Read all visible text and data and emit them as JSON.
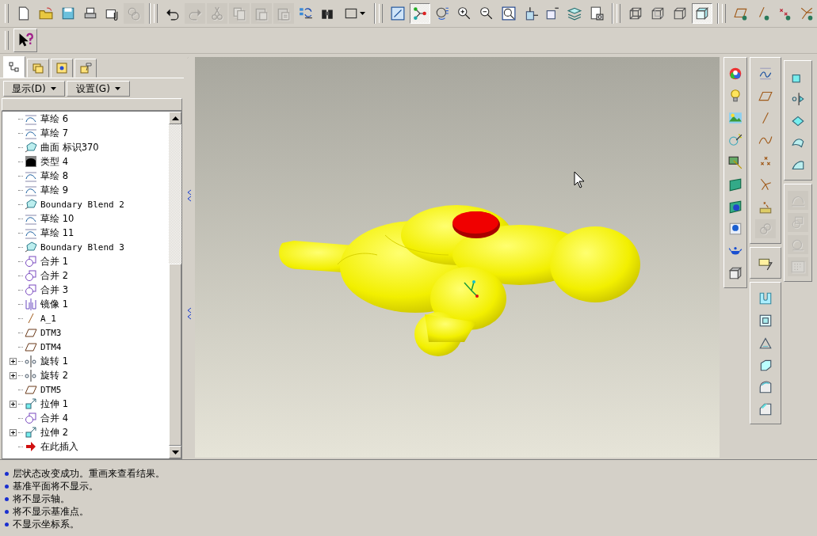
{
  "main_toolbar": {
    "buttons": [
      {
        "selected": false,
        "disabled": false
      },
      {
        "selected": false,
        "disabled": false
      },
      {
        "selected": false,
        "disabled": false
      },
      {
        "selected": false,
        "disabled": false
      },
      {
        "selected": false,
        "disabled": false
      },
      {
        "selected": false,
        "disabled": true
      },
      {
        "selected": false,
        "disabled": false
      },
      {
        "selected": false,
        "disabled": true
      },
      {
        "selected": false,
        "disabled": true
      },
      {
        "selected": false,
        "disabled": true
      },
      {
        "selected": false,
        "disabled": true
      },
      {
        "selected": false,
        "disabled": true
      },
      {
        "selected": false,
        "disabled": false
      },
      {
        "selected": false,
        "disabled": false
      },
      {
        "selected": false,
        "disabled": false
      },
      {
        "selected": false,
        "disabled": false
      },
      {
        "selected": true,
        "disabled": false
      },
      {
        "selected": false,
        "disabled": false
      },
      {
        "selected": false,
        "disabled": false
      },
      {
        "selected": false,
        "disabled": false
      },
      {
        "selected": false,
        "disabled": false
      },
      {
        "selected": false,
        "disabled": false
      },
      {
        "selected": false,
        "disabled": false
      },
      {
        "selected": false,
        "disabled": false
      },
      {
        "selected": false,
        "disabled": false
      },
      {
        "selected": false,
        "disabled": false
      },
      {
        "selected": false,
        "disabled": false
      },
      {
        "selected": false,
        "disabled": false
      },
      {
        "selected": true,
        "disabled": false
      },
      {
        "selected": false,
        "disabled": false
      },
      {
        "selected": false,
        "disabled": false
      },
      {
        "selected": false,
        "disabled": false
      },
      {
        "selected": false,
        "disabled": false
      }
    ]
  },
  "model_tree": {
    "tabs": [
      {
        "selected": true
      },
      {
        "selected": false
      },
      {
        "selected": false
      },
      {
        "selected": false
      }
    ],
    "menus": [
      {
        "label": "显示(D)"
      },
      {
        "label": "设置(G)"
      }
    ],
    "items": [
      {
        "kind": "sketch",
        "label": "草绘 6",
        "expandable": false
      },
      {
        "kind": "sketch",
        "label": "草绘 7",
        "expandable": false
      },
      {
        "kind": "surface",
        "label": "曲面 标识370",
        "expandable": false
      },
      {
        "kind": "type",
        "label": "类型 4",
        "expandable": false
      },
      {
        "kind": "sketch",
        "label": "草绘 8",
        "expandable": false
      },
      {
        "kind": "sketch",
        "label": "草绘 9",
        "expandable": false
      },
      {
        "kind": "surface",
        "label": "Boundary Blend 2",
        "expandable": false
      },
      {
        "kind": "sketch",
        "label": "草绘 10",
        "expandable": false
      },
      {
        "kind": "sketch",
        "label": "草绘 11",
        "expandable": false
      },
      {
        "kind": "surface",
        "label": "Boundary Blend 3",
        "expandable": false
      },
      {
        "kind": "merge",
        "label": "合并 1",
        "expandable": false
      },
      {
        "kind": "merge",
        "label": "合并 2",
        "expandable": false
      },
      {
        "kind": "merge",
        "label": "合并 3",
        "expandable": false
      },
      {
        "kind": "mirror",
        "label": "镜像 1",
        "expandable": false
      },
      {
        "kind": "axis",
        "label": "A_1",
        "expandable": false
      },
      {
        "kind": "plane",
        "label": "DTM3",
        "expandable": false
      },
      {
        "kind": "plane",
        "label": "DTM4",
        "expandable": false
      },
      {
        "kind": "revolve",
        "label": "旋转 1",
        "expandable": true
      },
      {
        "kind": "revolve",
        "label": "旋转 2",
        "expandable": true
      },
      {
        "kind": "plane",
        "label": "DTM5",
        "expandable": false
      },
      {
        "kind": "extrude",
        "label": "拉伸 1",
        "expandable": true
      },
      {
        "kind": "merge",
        "label": "合并 4",
        "expandable": false
      },
      {
        "kind": "extrude",
        "label": "拉伸 2",
        "expandable": true
      },
      {
        "kind": "insert",
        "label": "在此插入",
        "expandable": false
      }
    ]
  },
  "right_toolbars": [
    {
      "buttons": [
        {
          "disabled": false
        },
        {
          "disabled": false
        },
        {
          "disabled": false
        },
        {
          "disabled": false
        },
        {
          "disabled": false
        },
        {
          "disabled": false
        },
        {
          "disabled": false
        },
        {
          "disabled": false
        },
        {
          "disabled": false
        },
        {
          "disabled": false
        }
      ]
    },
    {
      "buttons": [
        {
          "disabled": false
        },
        {
          "disabled": false
        },
        {
          "disabled": false
        },
        {
          "disabled": false
        },
        {
          "disabled": false
        },
        {
          "disabled": false
        },
        {
          "disabled": false
        },
        {
          "disabled": true
        },
        {
          "disabled": false
        },
        {
          "disabled": false
        },
        {
          "disabled": false
        },
        {
          "disabled": false
        },
        {
          "disabled": false
        },
        {
          "disabled": false
        },
        {
          "disabled": false
        }
      ]
    },
    {
      "buttons": [
        {
          "disabled": false
        },
        {
          "disabled": false
        },
        {
          "disabled": false
        },
        {
          "disabled": false
        },
        {
          "disabled": false
        },
        {
          "disabled": true
        },
        {
          "disabled": true
        },
        {
          "disabled": true
        },
        {
          "disabled": true
        }
      ]
    }
  ],
  "messages": [
    "层状态改变成功。重画来查看结果。",
    "基准平面将不显示。",
    "将不显示轴。",
    "将不显示基准点。",
    "不显示坐标系。"
  ]
}
